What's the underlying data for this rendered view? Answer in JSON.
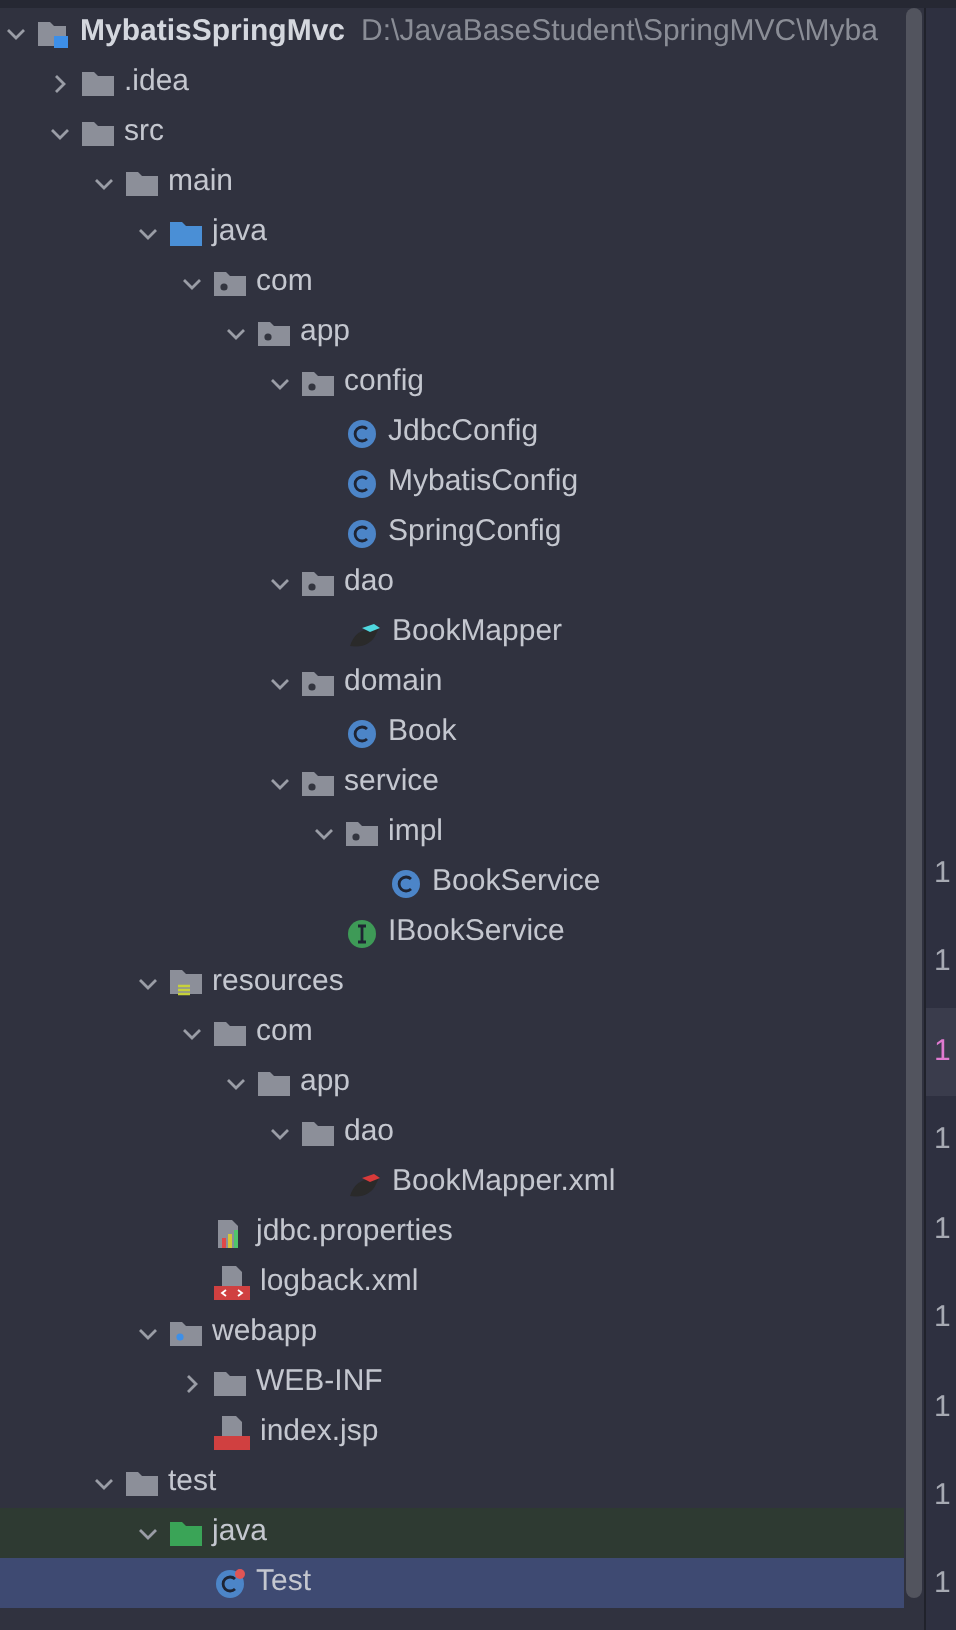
{
  "project_tree": {
    "root": {
      "name": "MybatisSpringMvc",
      "path": "D:\\JavaBaseStudent\\SpringMVC\\Myba",
      "kind": "module",
      "expanded": true,
      "selected": false,
      "highlighted": false,
      "children": [
        {
          "name": ".idea",
          "kind": "folder",
          "expanded": false,
          "selected": false,
          "highlighted": false
        },
        {
          "name": "src",
          "kind": "folder",
          "expanded": true,
          "selected": false,
          "highlighted": false,
          "children": [
            {
              "name": "main",
              "kind": "folder",
              "expanded": true,
              "selected": false,
              "highlighted": false,
              "children": [
                {
                  "name": "java",
                  "kind": "source-folder",
                  "expanded": true,
                  "selected": false,
                  "highlighted": false,
                  "children": [
                    {
                      "name": "com",
                      "kind": "package",
                      "expanded": true,
                      "selected": false,
                      "highlighted": false,
                      "children": [
                        {
                          "name": "app",
                          "kind": "package",
                          "expanded": true,
                          "selected": false,
                          "highlighted": false,
                          "children": [
                            {
                              "name": "config",
                              "kind": "package",
                              "expanded": true,
                              "selected": false,
                              "highlighted": false,
                              "children": [
                                {
                                  "name": "JdbcConfig",
                                  "kind": "class",
                                  "selected": false,
                                  "highlighted": false
                                },
                                {
                                  "name": "MybatisConfig",
                                  "kind": "class",
                                  "selected": false,
                                  "highlighted": false
                                },
                                {
                                  "name": "SpringConfig",
                                  "kind": "class",
                                  "selected": false,
                                  "highlighted": false
                                }
                              ]
                            },
                            {
                              "name": "dao",
                              "kind": "package",
                              "expanded": true,
                              "selected": false,
                              "highlighted": false,
                              "children": [
                                {
                                  "name": "BookMapper",
                                  "kind": "mapper",
                                  "selected": false,
                                  "highlighted": false
                                }
                              ]
                            },
                            {
                              "name": "domain",
                              "kind": "package",
                              "expanded": true,
                              "selected": false,
                              "highlighted": false,
                              "children": [
                                {
                                  "name": "Book",
                                  "kind": "class",
                                  "selected": false,
                                  "highlighted": false
                                }
                              ]
                            },
                            {
                              "name": "service",
                              "kind": "package",
                              "expanded": true,
                              "selected": false,
                              "highlighted": false,
                              "children": [
                                {
                                  "name": "impl",
                                  "kind": "package",
                                  "expanded": true,
                                  "selected": false,
                                  "highlighted": false,
                                  "children": [
                                    {
                                      "name": "BookService",
                                      "kind": "class",
                                      "selected": false,
                                      "highlighted": false
                                    }
                                  ]
                                },
                                {
                                  "name": "IBookService",
                                  "kind": "interface",
                                  "selected": false,
                                  "highlighted": false
                                }
                              ]
                            }
                          ]
                        }
                      ]
                    }
                  ]
                },
                {
                  "name": "resources",
                  "kind": "resources-folder",
                  "expanded": true,
                  "selected": false,
                  "highlighted": false,
                  "children": [
                    {
                      "name": "com",
                      "kind": "folder",
                      "expanded": true,
                      "selected": false,
                      "highlighted": false,
                      "children": [
                        {
                          "name": "app",
                          "kind": "folder",
                          "expanded": true,
                          "selected": false,
                          "highlighted": false,
                          "children": [
                            {
                              "name": "dao",
                              "kind": "folder",
                              "expanded": true,
                              "selected": false,
                              "highlighted": false,
                              "children": [
                                {
                                  "name": "BookMapper.xml",
                                  "kind": "mapper-xml",
                                  "selected": false,
                                  "highlighted": false
                                }
                              ]
                            }
                          ]
                        }
                      ]
                    },
                    {
                      "name": "jdbc.properties",
                      "kind": "properties",
                      "selected": false,
                      "highlighted": false
                    },
                    {
                      "name": "logback.xml",
                      "kind": "xml",
                      "selected": false,
                      "highlighted": false
                    }
                  ]
                },
                {
                  "name": "webapp",
                  "kind": "web-folder",
                  "expanded": true,
                  "selected": false,
                  "highlighted": false,
                  "children": [
                    {
                      "name": "WEB-INF",
                      "kind": "folder",
                      "expanded": false,
                      "selected": false,
                      "highlighted": false
                    },
                    {
                      "name": "index.jsp",
                      "kind": "jsp",
                      "selected": false,
                      "highlighted": false
                    }
                  ]
                }
              ]
            },
            {
              "name": "test",
              "kind": "folder",
              "expanded": true,
              "selected": false,
              "highlighted": false,
              "children": [
                {
                  "name": "java",
                  "kind": "test-folder",
                  "expanded": true,
                  "selected": false,
                  "highlighted": true,
                  "children": [
                    {
                      "name": "Test",
                      "kind": "test-class",
                      "selected": true,
                      "highlighted": false
                    }
                  ]
                }
              ]
            }
          ]
        }
      ]
    }
  },
  "editor_gutter": {
    "line_numbers": [
      {
        "text": "1",
        "current": false
      },
      {
        "text": "1",
        "current": false
      },
      {
        "text": "1",
        "current": true
      },
      {
        "text": "1",
        "current": false
      },
      {
        "text": "1",
        "current": false
      },
      {
        "text": "1",
        "current": false
      },
      {
        "text": "1",
        "current": false
      },
      {
        "text": "1",
        "current": false
      },
      {
        "text": "1",
        "current": false
      }
    ]
  }
}
